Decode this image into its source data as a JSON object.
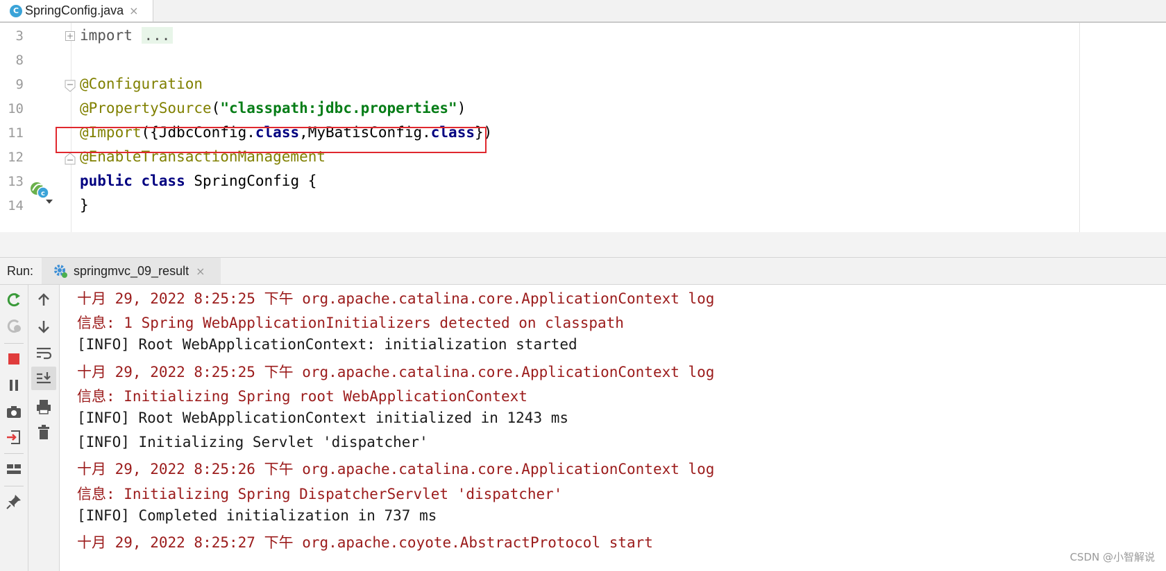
{
  "editor_tab": {
    "icon": "C",
    "filename": "SpringConfig.java",
    "close": "×"
  },
  "editor": {
    "lines": [
      {
        "num": "3",
        "parts": [
          {
            "t": "import ",
            "c": "dim"
          },
          {
            "t": "...",
            "c": "ellipsis"
          }
        ]
      },
      {
        "num": "8",
        "parts": []
      },
      {
        "num": "9",
        "parts": [
          {
            "t": "@Configuration",
            "c": "ann"
          }
        ]
      },
      {
        "num": "10",
        "parts": [
          {
            "t": "@PropertySource",
            "c": "ann"
          },
          {
            "t": "(",
            "c": "plain"
          },
          {
            "t": "\"classpath:jdbc.properties\"",
            "c": "str"
          },
          {
            "t": ")",
            "c": "plain"
          }
        ]
      },
      {
        "num": "11",
        "parts": [
          {
            "t": "@Import",
            "c": "ann"
          },
          {
            "t": "({JdbcConfig.",
            "c": "plain"
          },
          {
            "t": "class",
            "c": "kw"
          },
          {
            "t": ",MyBatisConfig.",
            "c": "plain"
          },
          {
            "t": "class",
            "c": "kw"
          },
          {
            "t": "})",
            "c": "plain"
          }
        ]
      },
      {
        "num": "12",
        "parts": [
          {
            "t": "@EnableTransactionManagement",
            "c": "ann"
          }
        ]
      },
      {
        "num": "13",
        "parts": [
          {
            "t": "public class ",
            "c": "kw"
          },
          {
            "t": "SpringConfig {",
            "c": "plain"
          }
        ]
      },
      {
        "num": "14",
        "parts": [
          {
            "t": "}",
            "c": "plain"
          }
        ]
      }
    ]
  },
  "run_panel": {
    "label": "Run:",
    "tab_name": "springmvc_09_result",
    "close": "×"
  },
  "console": {
    "lines": [
      {
        "text": "十月 29, 2022 8:25:25 下午 org.apache.catalina.core.ApplicationContext log",
        "style": "red"
      },
      {
        "text": "信息: 1 Spring WebApplicationInitializers detected on classpath",
        "style": "red"
      },
      {
        "text": "[INFO] Root WebApplicationContext: initialization started",
        "style": "black"
      },
      {
        "text": "十月 29, 2022 8:25:25 下午 org.apache.catalina.core.ApplicationContext log",
        "style": "red"
      },
      {
        "text": "信息: Initializing Spring root WebApplicationContext",
        "style": "red"
      },
      {
        "text": "[INFO] Root WebApplicationContext initialized in 1243 ms",
        "style": "black"
      },
      {
        "text": "[INFO] Initializing Servlet 'dispatcher'",
        "style": "black"
      },
      {
        "text": "十月 29, 2022 8:25:26 下午 org.apache.catalina.core.ApplicationContext log",
        "style": "red"
      },
      {
        "text": "信息: Initializing Spring DispatcherServlet 'dispatcher'",
        "style": "red"
      },
      {
        "text": "[INFO] Completed initialization in 737 ms",
        "style": "black"
      },
      {
        "text": "十月 29, 2022 8:25:27 下午 org.apache.coyote.AbstractProtocol start",
        "style": "red"
      }
    ]
  },
  "watermark": "CSDN @小智解说",
  "colors": {
    "annotation": "#808000",
    "string": "#067d17",
    "keyword": "#000080",
    "log_red": "#9b1b1b",
    "highlight_box": "#e0282e"
  },
  "icons": {
    "toolbar_left": [
      "rerun-icon",
      "rerun-failed-icon",
      "stop-icon",
      "pause-icon",
      "camera-icon",
      "exit-icon",
      "layout-icon",
      "pin-icon"
    ],
    "toolbar_right": [
      "up-arrow-icon",
      "down-arrow-icon",
      "soft-wrap-icon",
      "scroll-to-end-icon",
      "print-icon",
      "trash-icon"
    ]
  }
}
